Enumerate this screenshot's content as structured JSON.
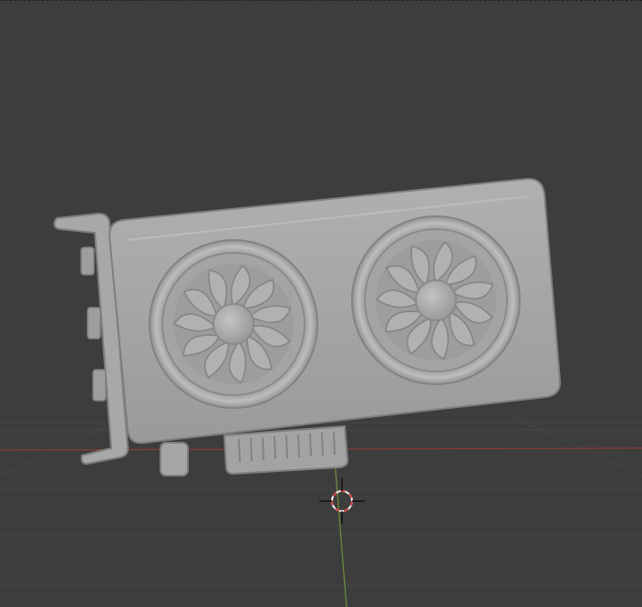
{
  "app": "3D viewport",
  "colors": {
    "background": "#3d3d3d",
    "grid_line": "#464646",
    "x_axis": "#8b3a3a",
    "y_axis": "#6f8f3a",
    "model": "#a9a9a9",
    "cursor_red": "#d64545",
    "cursor_white": "#f0f0f0"
  },
  "viewport": {
    "object": "graphics-card-model",
    "fans": 2,
    "cursor": "3d-cursor"
  }
}
